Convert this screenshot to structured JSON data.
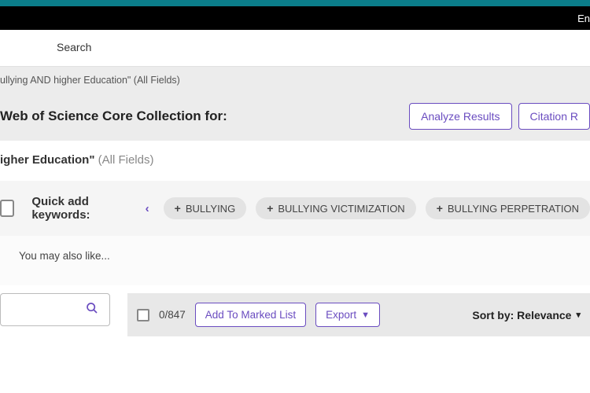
{
  "header": {
    "lang_partial": "En"
  },
  "tabs": {
    "search_label": "Search"
  },
  "query": {
    "summary_partial": "ullying AND higher Education\" (All Fields)",
    "heading_partial": "Web of Science Core Collection for:",
    "detail_prefix": "igher Education\"",
    "detail_scope": "(All Fields)"
  },
  "actions": {
    "analyze": "Analyze Results",
    "citation_partial": "Citation R"
  },
  "quick_add": {
    "label": "Quick add keywords:",
    "chips": [
      "BULLYING",
      "BULLYING VICTIMIZATION",
      "BULLYING PERPETRATION"
    ]
  },
  "also_like": "You may also like...",
  "toolbar": {
    "count": "0/847",
    "marked": "Add To Marked List",
    "export": "Export",
    "sort": "Sort by: Relevance"
  }
}
